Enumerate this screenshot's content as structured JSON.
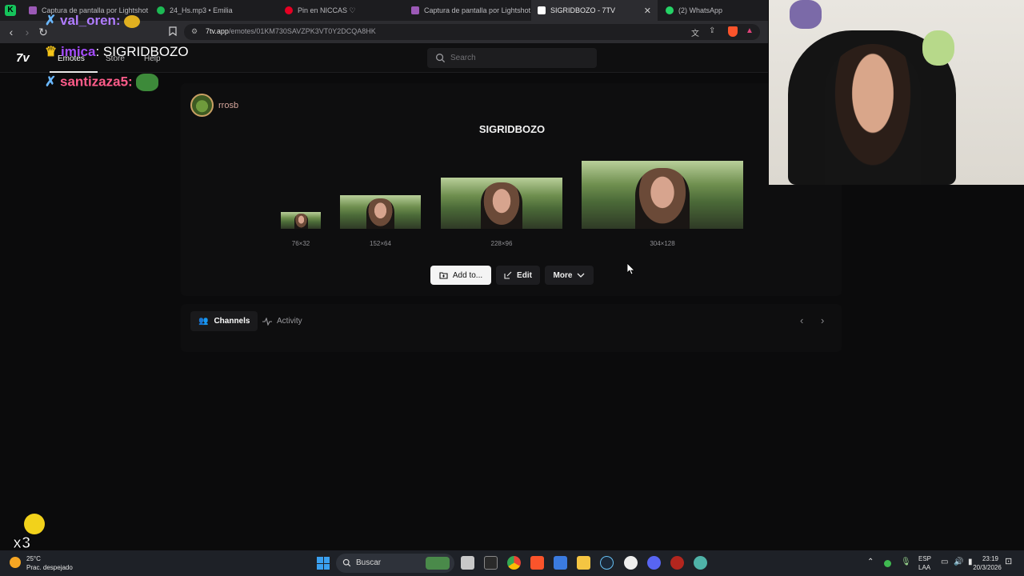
{
  "browser": {
    "tabs": [
      {
        "label": "Captura de pantalla por Lightshot",
        "icon": "feather-icon",
        "color": "#9b59b6"
      },
      {
        "label": "24_Hs.mp3 • Emilia",
        "icon": "spotify-icon",
        "color": "#1db954"
      },
      {
        "label": "Pin en NICCAS ♡",
        "icon": "pinterest-icon",
        "color": "#e60023"
      },
      {
        "label": "Captura de pantalla por Lightshot",
        "icon": "feather-icon",
        "color": "#9b59b6"
      },
      {
        "label": "SIGRIDBOZO - 7TV",
        "icon": "7tv-icon",
        "color": "#ffffff"
      },
      {
        "label": "(2) WhatsApp",
        "icon": "whatsapp-icon",
        "color": "#25d366"
      }
    ],
    "url_host": "7tv.app",
    "url_path": "/emotes/01KM730SAVZPK3VT0Y2DCQA8HK"
  },
  "site": {
    "logo": "7v",
    "nav": [
      "Emotes",
      "Store",
      "Help"
    ],
    "search_placeholder": "Search"
  },
  "emote": {
    "owner": "rrosb",
    "name": "SIGRIDBOZO",
    "sizes": [
      "76×32",
      "152×64",
      "228×96",
      "304×128"
    ],
    "actions": {
      "add": "Add to...",
      "edit": "Edit",
      "more": "More"
    }
  },
  "section_tabs": {
    "channels": "Channels",
    "activity": "Activity"
  },
  "overlay_chat": [
    {
      "user": "val_oren:",
      "message": "",
      "color": "#b07cff"
    },
    {
      "user": "imica",
      "message": ": SIGRIDBOZO",
      "color": "#a64dff"
    },
    {
      "user": "santizaza5:",
      "message": "",
      "color": "#ff5c8a"
    }
  ],
  "overlay_counter": "x3",
  "taskbar": {
    "search_label": "Buscar",
    "weather_temp": "25°C",
    "weather_desc": "Prac. despejado",
    "lang_1": "ESP",
    "lang_2": "LAA",
    "time": "23:19",
    "date": "20/3/2026"
  },
  "colors": {
    "accent": "#ffffff",
    "owner_name": "#d6a69c",
    "taskbar": "#1e2127"
  }
}
